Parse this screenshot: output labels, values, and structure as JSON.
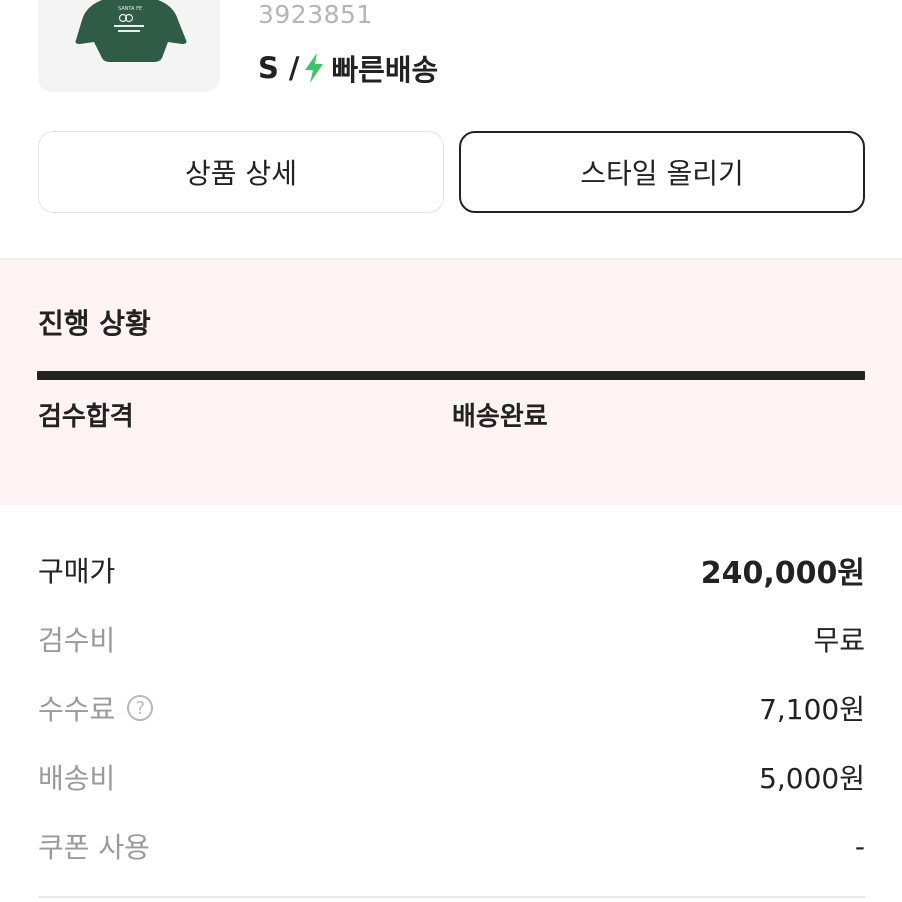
{
  "product": {
    "code": "3923851",
    "size": "S",
    "separator": "/",
    "shipping_label": "빠른배송",
    "bolt_color": "#3cc46a",
    "image_icon": "green-sweatshirt-image"
  },
  "actions": {
    "detail_label": "상품 상세",
    "style_label": "스타일 올리기"
  },
  "progress": {
    "title": "진행 상황",
    "steps": [
      "검수합격",
      "배송완료"
    ],
    "completion": 1.0,
    "background_color": "#fdf3f2"
  },
  "prices": [
    {
      "label": "구매가",
      "value": "240,000원"
    },
    {
      "label": "검수비",
      "value": "무료"
    },
    {
      "label": "수수료",
      "value": "7,100원",
      "help_icon": "?"
    },
    {
      "label": "배송비",
      "value": "5,000원"
    },
    {
      "label": "쿠폰 사용",
      "value": "-"
    }
  ]
}
